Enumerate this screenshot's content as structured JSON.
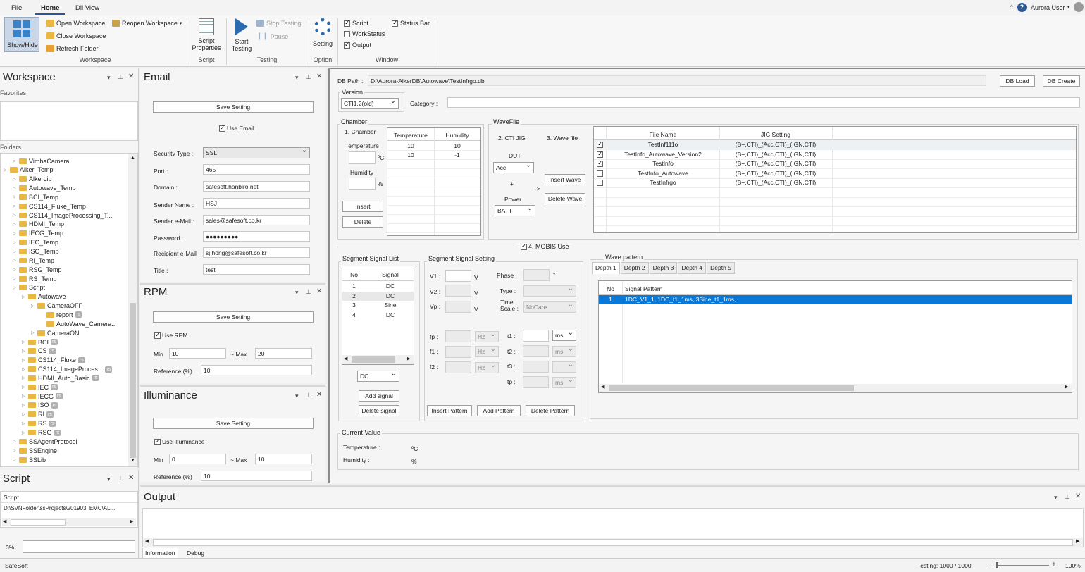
{
  "ribbon": {
    "tabs": [
      "File",
      "Home",
      "Dll View"
    ],
    "user": "Aurora User",
    "show_hide": "Show/Hide",
    "open_workspace": "Open Workspace",
    "reopen_workspace": "Reopen Workspace",
    "close_workspace": "Close Workspace",
    "refresh_folder": "Refresh Folder",
    "group_workspace": "Workspace",
    "script_properties_1": "Script",
    "script_properties_2": "Properties",
    "group_script": "Script",
    "start_testing_1": "Start",
    "start_testing_2": "Testing",
    "stop_testing": "Stop Testing",
    "pause": "Pause",
    "group_testing": "Testing",
    "setting": "Setting",
    "group_option": "Option",
    "chk_script": "Script",
    "chk_workstatus": "WorkStatus",
    "chk_output": "Output",
    "chk_statusbar": "Status Bar",
    "group_window": "Window"
  },
  "workspace": {
    "title": "Workspace",
    "favorites": "Favorites",
    "folders": "Folders",
    "tree": [
      {
        "label": "VimbaCamera",
        "indent": 1,
        "rs": false
      },
      {
        "label": "Alker_Temp",
        "indent": 0,
        "rs": false
      },
      {
        "label": "AlkerLib",
        "indent": 1,
        "rs": false
      },
      {
        "label": "Autowave_Temp",
        "indent": 1,
        "rs": false
      },
      {
        "label": "BCI_Temp",
        "indent": 1,
        "rs": false
      },
      {
        "label": "CS114_Fluke_Temp",
        "indent": 1,
        "rs": false
      },
      {
        "label": "CS114_ImageProcessing_T...",
        "indent": 1,
        "rs": false
      },
      {
        "label": "HDMI_Temp",
        "indent": 1,
        "rs": false
      },
      {
        "label": "IECG_Temp",
        "indent": 1,
        "rs": false
      },
      {
        "label": "IEC_Temp",
        "indent": 1,
        "rs": false
      },
      {
        "label": "ISO_Temp",
        "indent": 1,
        "rs": false
      },
      {
        "label": "RI_Temp",
        "indent": 1,
        "rs": false
      },
      {
        "label": "RSG_Temp",
        "indent": 1,
        "rs": false
      },
      {
        "label": "RS_Temp",
        "indent": 1,
        "rs": false
      },
      {
        "label": "Script",
        "indent": 1,
        "rs": false
      },
      {
        "label": "Autowave",
        "indent": 2,
        "rs": false
      },
      {
        "label": "CameraOFF",
        "indent": 3,
        "rs": false
      },
      {
        "label": "report",
        "indent": 4,
        "rs": true
      },
      {
        "label": "AutoWave_Camera...",
        "indent": 4,
        "rs": false
      },
      {
        "label": "CameraON",
        "indent": 3,
        "rs": false
      },
      {
        "label": "BCI",
        "indent": 2,
        "rs": true
      },
      {
        "label": "CS",
        "indent": 2,
        "rs": true
      },
      {
        "label": "CS114_Fluke",
        "indent": 2,
        "rs": true
      },
      {
        "label": "CS114_ImageProces...",
        "indent": 2,
        "rs": true
      },
      {
        "label": "HDMI_Auto_Basic",
        "indent": 2,
        "rs": true
      },
      {
        "label": "IEC",
        "indent": 2,
        "rs": true
      },
      {
        "label": "IECG",
        "indent": 2,
        "rs": true
      },
      {
        "label": "ISO",
        "indent": 2,
        "rs": true
      },
      {
        "label": "RI",
        "indent": 2,
        "rs": true
      },
      {
        "label": "RS",
        "indent": 2,
        "rs": true
      },
      {
        "label": "RSG",
        "indent": 2,
        "rs": true
      },
      {
        "label": "SSAgentProtocol",
        "indent": 1,
        "rs": false
      },
      {
        "label": "SSEngine",
        "indent": 1,
        "rs": false
      },
      {
        "label": "SSLib",
        "indent": 1,
        "rs": false
      }
    ],
    "rs_badge": "rs"
  },
  "script_panel": {
    "title": "Script",
    "col": "Script",
    "path": "D:\\SVNFolder\\ssProjects\\201903_EMC\\AL...",
    "progress": "0%"
  },
  "email": {
    "title": "Email",
    "save": "Save Setting",
    "use_email": "Use Email",
    "security_label": "Security Type :",
    "security": "SSL",
    "port_label": "Port :",
    "port": "465",
    "domain_label": "Domain :",
    "domain": "safesoft.hanbiro.net",
    "sender_name_label": "Sender Name :",
    "sender_name": "HSJ",
    "sender_email_label": "Sender e-Mail :",
    "sender_email": "sales@safesoft.co.kr",
    "password_label": "Password :",
    "password": "●●●●●●●●●",
    "recipient_label": "Recipient e-Mail :",
    "recipient": "sj.hong@safesoft.co.kr",
    "title_label": "Title :",
    "title_value": "test"
  },
  "rpm": {
    "title": "RPM",
    "save": "Save Setting",
    "use": "Use RPM",
    "min_label": "Min",
    "min": "10",
    "max_label": "~ Max",
    "max": "20",
    "ref_label": "Reference (%)",
    "ref": "10"
  },
  "illum": {
    "title": "Illuminance",
    "save": "Save Setting",
    "use": "Use Illuminance",
    "min_label": "Min",
    "min": "0",
    "max_label": "~ Max",
    "max": "10",
    "ref_label": "Reference (%)",
    "ref": "10"
  },
  "main": {
    "db_path_label": "DB Path :",
    "db_path": "D:\\Aurora-AlkerDB\\Autowave\\TestInfrgo.db",
    "db_load": "DB Load",
    "db_create": "DB Create",
    "version_label": "Version",
    "version": "CTI1,2(old)",
    "category_label": "Category :",
    "chamber": {
      "title": "Chamber",
      "step": "1. Chamber",
      "temp_label": "Temperature",
      "temp_unit": "ºC",
      "hum_label": "Humidity",
      "hum_unit": "%",
      "insert": "Insert",
      "delete": "Delete",
      "cols": [
        "Temperature",
        "Humidity"
      ],
      "rows": [
        [
          "10",
          "10"
        ],
        [
          "10",
          "-1"
        ]
      ]
    },
    "wavefile": {
      "title": "WaveFile",
      "cti_jig": "2. CTI JIG",
      "wave_file": "3. Wave file",
      "dut_label": "DUT",
      "dut": "Acc",
      "plus": "+",
      "arrow": "->",
      "power_label": "Power",
      "power": "BATT",
      "insert_wave": "Insert Wave",
      "delete_wave": "Delete Wave",
      "cols": [
        "File Name",
        "JIG Setting"
      ],
      "rows": [
        {
          "checked": true,
          "name": "TestInf111o",
          "jig": "(B+,CTI)_(Acc,CTI)_(IGN,CTI)"
        },
        {
          "checked": true,
          "name": "TestInfo_Autowave_Version2",
          "jig": "(B+,CTI)_(Acc,CTI)_(IGN,CTI)"
        },
        {
          "checked": true,
          "name": "TestInfo",
          "jig": "(B+,CTI)_(Acc,CTI)_(IGN,CTI)"
        },
        {
          "checked": false,
          "name": "TestInfo_Autowave",
          "jig": "(B+,CTI)_(Acc,CTI)_(IGN,CTI)"
        },
        {
          "checked": false,
          "name": "TestInfrgo",
          "jig": "(B+,CTI)_(Acc,CTI)_(IGN,CTI)"
        }
      ]
    },
    "mobis": "4. MOBIS Use",
    "segment_list": {
      "title": "Segment Signal List",
      "cols": [
        "No",
        "Signal"
      ],
      "rows": [
        [
          "1",
          "DC"
        ],
        [
          "2",
          "DC"
        ],
        [
          "3",
          "Sine"
        ],
        [
          "4",
          "DC"
        ]
      ],
      "signal_type": "DC",
      "add": "Add signal",
      "delete": "Delete signal"
    },
    "segment_setting": {
      "title": "Segment Signal Setting",
      "v1": "V1 :",
      "v2": "V2 :",
      "vp": "Vp :",
      "v_unit": "V",
      "phase": "Phase :",
      "phase_unit": "°",
      "type": "Type :",
      "time_scale_1": "Time",
      "time_scale_2": "Scale :",
      "time_scale": "NoCare",
      "fp": "fp :",
      "f1": "f1 :",
      "f2": "f2 :",
      "hz": "Hz",
      "t1": "t1 :",
      "t2": "t2 :",
      "t3": "t3 :",
      "tp": "tp :",
      "ms": "ms",
      "insert_pattern": "Insert Pattern",
      "add_pattern": "Add Pattern",
      "delete_pattern": "Delete Pattern"
    },
    "wave_pattern": {
      "title": "Wave pattern",
      "tabs": [
        "Depth 1",
        "Depth 2",
        "Depth 3",
        "Depth 4",
        "Depth 5"
      ],
      "cols": [
        "No",
        "Signal Pattern"
      ],
      "rows": [
        [
          "1",
          "1DC_V1_1, 1DC_t1_1ms, 3Sine_t1_1ms,"
        ]
      ]
    },
    "current": {
      "title": "Current Value",
      "temp_label": "Temperature :",
      "temp_unit": "ºC",
      "hum_label": "Humidity :",
      "hum_unit": "%"
    }
  },
  "output": {
    "title": "Output",
    "tabs": [
      "Information",
      "Debug"
    ]
  },
  "status": {
    "left": "SafeSoft",
    "testing": "Testing: 1000 / 1000",
    "zoom": "100%"
  }
}
